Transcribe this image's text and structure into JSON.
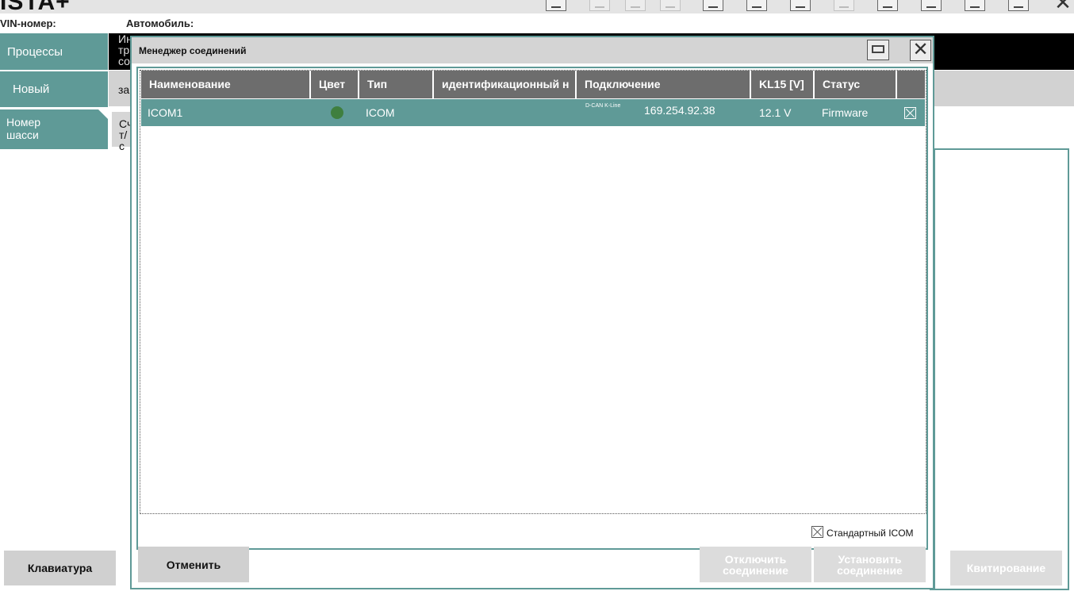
{
  "app": {
    "title": "ISTA+",
    "close_glyph": "✕"
  },
  "info": {
    "vin_label": "VIN-номер:",
    "car_label": "Автомобиль:"
  },
  "toolbar": {
    "icons": [
      "home-icon",
      "back-icon",
      "copy-icon",
      "forward-icon",
      "edit-icon",
      "list-icon",
      "tool-icon",
      "image-icon",
      "phone-icon",
      "print-icon",
      "help-icon",
      "collapse-icon"
    ]
  },
  "nav": {
    "processes": "Процессы",
    "new": "Новый",
    "chassis_line1": "Номер",
    "chassis_line2": "шасси"
  },
  "peek": {
    "black_l1": "Ин",
    "black_l2": "тр",
    "black_l3": "со",
    "grey": "за",
    "side_l1": "Сч",
    "side_l2": "т/с"
  },
  "buttons": {
    "keyboard": "Клавиатура",
    "acknowledge": "Квитирование"
  },
  "dialog": {
    "title": "Менеджер соединений",
    "print_icon": "print-icon",
    "close_glyph": "✕",
    "columns": [
      "Наименование",
      "Цвет",
      "Тип",
      "идентификационный н",
      "Подключение",
      "KL15 [V]",
      "Статус",
      ""
    ],
    "rows": [
      {
        "name": "ICOM1",
        "color": "#3f7f3f",
        "type": "ICOM",
        "id": "",
        "interfaces": "D-CAN K-Line",
        "ip": "169.254.92.38",
        "kl15": "12.1 V",
        "status": "Firmware",
        "checked": true
      }
    ],
    "std_icom_label": "Стандартный ICOM",
    "std_icom_checked": true,
    "cancel": "Отменить",
    "disconnect_l1": "Отключить",
    "disconnect_l2": "соединение",
    "connect_l1": "Установить",
    "connect_l2": "соединение"
  }
}
